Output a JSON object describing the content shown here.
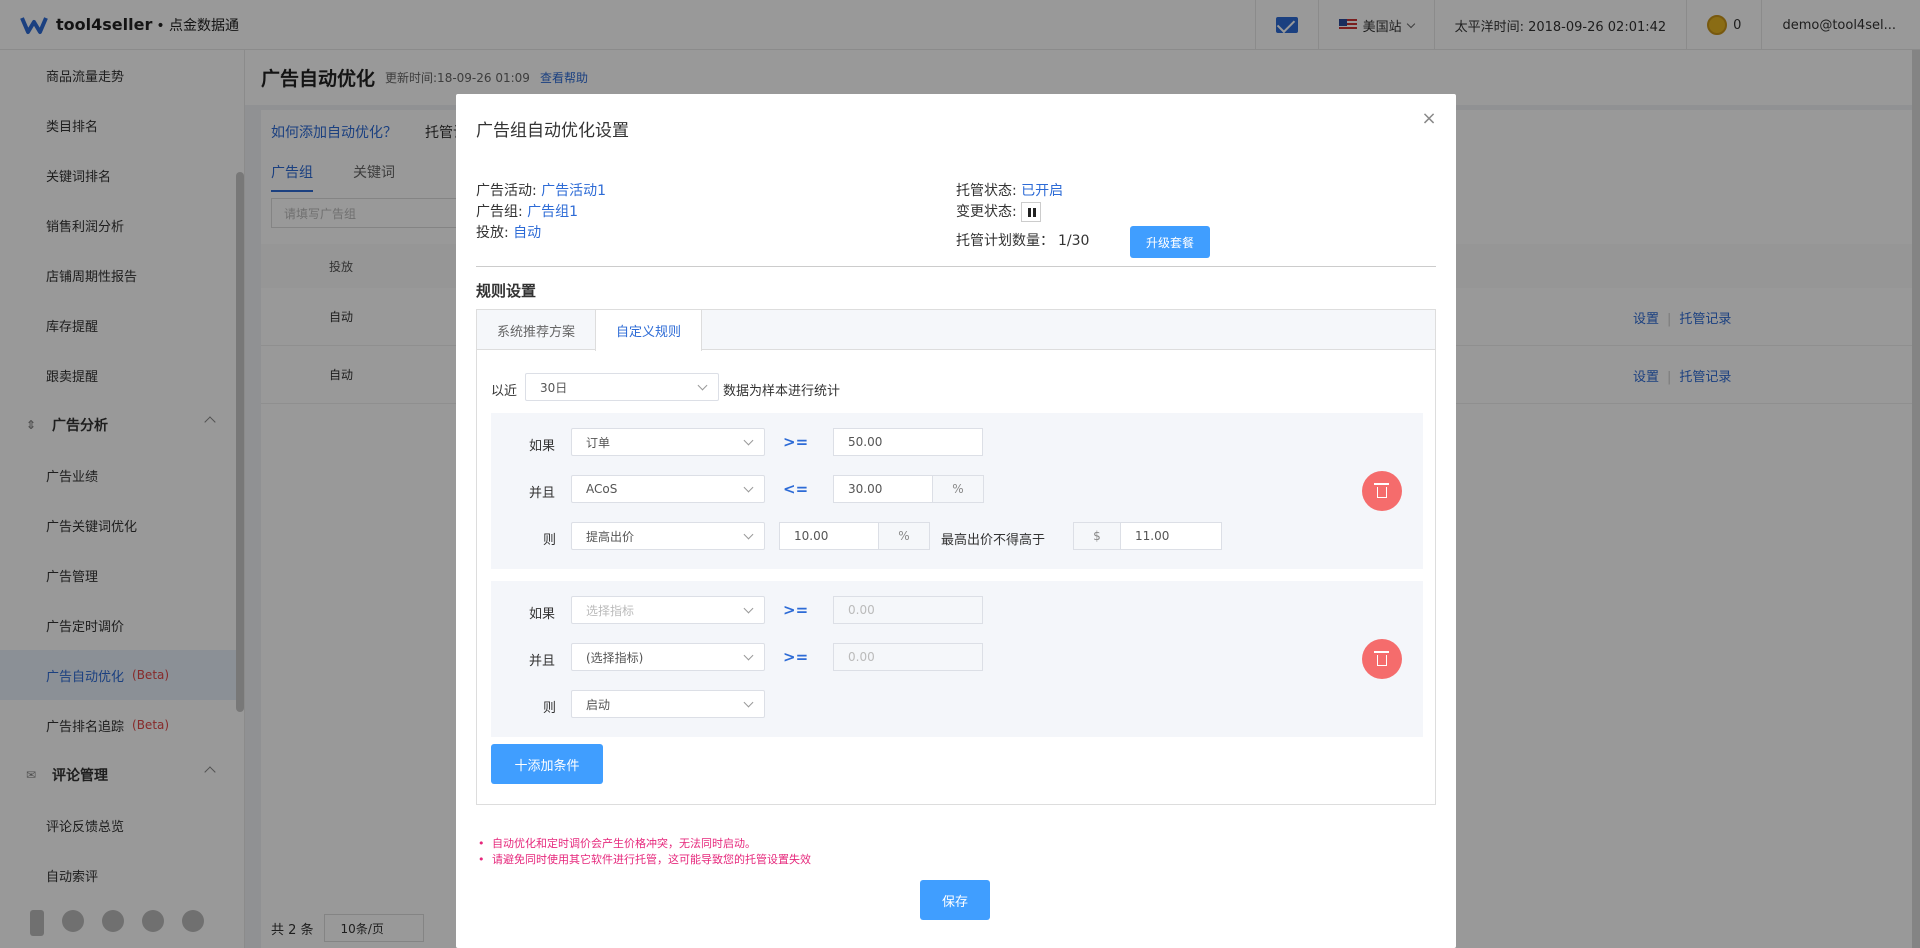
{
  "topbar": {
    "brand": "tool4seller",
    "brand_sub": "• 点金数据通",
    "region": "美国站",
    "time": "太平洋时间: 2018-09-26 02:01:42",
    "coins": "0",
    "user": "demo@tool4sel..."
  },
  "sidebar": {
    "items_top": [
      "商品流量走势",
      "类目排名",
      "关键词排名",
      "销售利润分析",
      "店铺周期性报告",
      "库存提醒",
      "跟卖提醒"
    ],
    "group_ads": "广告分析",
    "items_ads": [
      "广告业绩",
      "广告关键词优化",
      "广告管理",
      "广告定时调价"
    ],
    "active_item": "广告自动优化",
    "beta": "(Beta)",
    "item_rank": "广告排名追踪",
    "group_review": "评论管理",
    "items_review": [
      "评论反馈总览",
      "自动索评"
    ]
  },
  "page": {
    "title": "广告自动优化",
    "update": "更新时间:18-09-26 01:09",
    "help": "查看帮助",
    "how_link": "如何添加自动优化？",
    "tuoguan": "托管计",
    "tab_group": "广告组",
    "tab_keyword": "关键词",
    "search_placeholder": "请填写广告组",
    "th_delivery": "投放",
    "rows": [
      "自动",
      "自动"
    ],
    "op_set": "设置",
    "op_log": "托管记录",
    "total": "共 2 条",
    "page_size": "10条/页"
  },
  "modal": {
    "title": "广告组自动优化设置",
    "close": "×",
    "campaign_label": "广告活动:",
    "campaign": "广告活动1",
    "group_label": "广告组:",
    "group": "广告组1",
    "delivery_label": "投放:",
    "delivery": "自动",
    "status_label": "托管状态:",
    "status": "已开启",
    "change_label": "变更状态:",
    "plan_label": "托管计划数量：",
    "plan_value": "1/30",
    "upgrade": "升级套餐",
    "rule_title": "规则设置",
    "tabs": [
      "系统推荐方案",
      "自定义规则"
    ],
    "period_prefix": "以近",
    "period": "30日",
    "period_suffix": "数据为样本进行统计",
    "rule1": {
      "if_label": "如果",
      "if_metric": "订单",
      "if_op": ">=",
      "if_value": "50.00",
      "and_label": "并且",
      "and_metric": "ACoS",
      "and_op": "<=",
      "and_value": "30.00",
      "and_unit": "%",
      "then_label": "则",
      "then_action": "提高出价",
      "then_value": "10.00",
      "then_unit": "%",
      "max_label": "最高出价不得高于",
      "max_unit": "$",
      "max_value": "11.00"
    },
    "rule2": {
      "if_label": "如果",
      "if_metric": "选择指标",
      "if_op": ">=",
      "if_value": "0.00",
      "and_label": "并且",
      "and_metric": "(选择指标)",
      "and_op": ">=",
      "and_value": "0.00",
      "then_label": "则",
      "then_action": "启动"
    },
    "add_condition": "十添加条件",
    "notes": [
      "自动优化和定时调价会产生价格冲突，无法同时启动。",
      "请避免同时使用其它软件进行托管，这可能导致您的托管设置失效"
    ],
    "save": "保存"
  },
  "colors": {
    "accent": "#409eff",
    "link": "#2d6bd6",
    "danger": "#f56c6c",
    "note": "#e6287c"
  }
}
